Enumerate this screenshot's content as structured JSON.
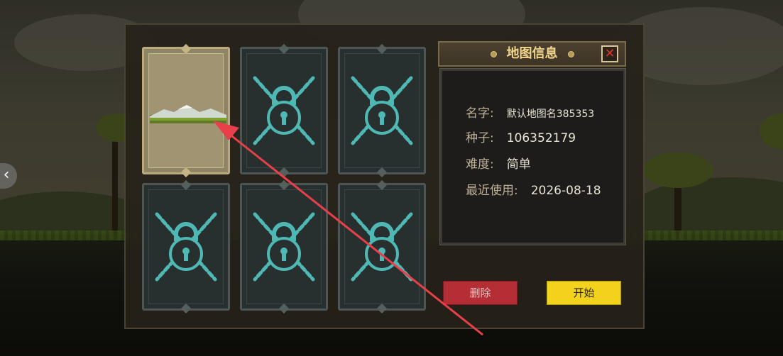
{
  "watermark_text": "",
  "info": {
    "title": "地图信息",
    "close_symbol": "✕",
    "name_label": "名字:",
    "name_value": "默认地图名385353",
    "seed_label": "种子:",
    "seed_value": "106352179",
    "difficulty_label": "难度:",
    "difficulty_value": "简单",
    "last_used_label": "最近使用:",
    "last_used_value": "2026-08-18"
  },
  "buttons": {
    "delete_label": "删除",
    "start_label": "开始"
  },
  "slots": [
    {
      "state": "unlocked",
      "icon": "landscape-icon"
    },
    {
      "state": "locked",
      "icon": "chained-lock-icon"
    },
    {
      "state": "locked",
      "icon": "chained-lock-icon"
    },
    {
      "state": "locked",
      "icon": "chained-lock-icon"
    },
    {
      "state": "locked",
      "icon": "chained-lock-icon"
    },
    {
      "state": "locked",
      "icon": "chained-lock-icon"
    }
  ],
  "nav": {
    "prev_symbol": "‹"
  },
  "colors": {
    "title_text": "#f2d58c",
    "lock_cyan": "#4fb8b4",
    "delete_button": "#b52e36",
    "start_button": "#f2d21d",
    "arrow_red": "#e8404a"
  }
}
